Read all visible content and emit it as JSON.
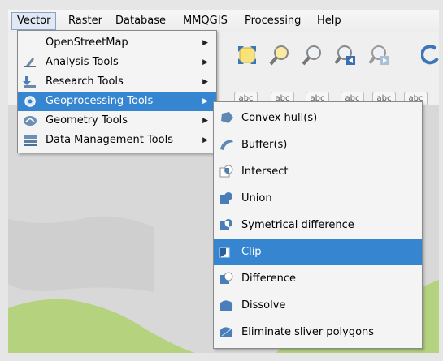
{
  "menubar": {
    "items": [
      "Vector",
      "Raster",
      "Database",
      "MMQGIS",
      "Processing",
      "Help"
    ],
    "active": "Vector"
  },
  "vector_menu": {
    "items": [
      {
        "label": "OpenStreetMap",
        "icon": "none",
        "has_submenu": true
      },
      {
        "label": "Analysis Tools",
        "icon": "analysis-icon",
        "has_submenu": true
      },
      {
        "label": "Research Tools",
        "icon": "research-icon",
        "has_submenu": true
      },
      {
        "label": "Geoprocessing Tools",
        "icon": "gear-icon",
        "has_submenu": true,
        "highlighted": true
      },
      {
        "label": "Geometry Tools",
        "icon": "geometry-icon",
        "has_submenu": true
      },
      {
        "label": "Data Management Tools",
        "icon": "data-management-icon",
        "has_submenu": true
      }
    ]
  },
  "geoprocessing_menu": {
    "items": [
      {
        "label": "Convex hull(s)",
        "icon": "convex-hull-icon"
      },
      {
        "label": "Buffer(s)",
        "icon": "buffer-icon"
      },
      {
        "label": "Intersect",
        "icon": "intersect-icon"
      },
      {
        "label": "Union",
        "icon": "union-icon"
      },
      {
        "label": "Symetrical difference",
        "icon": "symmetrical-difference-icon"
      },
      {
        "label": "Clip",
        "icon": "clip-icon",
        "highlighted": true
      },
      {
        "label": "Difference",
        "icon": "difference-icon"
      },
      {
        "label": "Dissolve",
        "icon": "dissolve-icon"
      },
      {
        "label": "Eliminate sliver polygons",
        "icon": "eliminate-sliver-icon"
      }
    ]
  },
  "toolbar": {
    "label_buttons": [
      "abc",
      "abc",
      "abc",
      "abc",
      "abc",
      "abc"
    ]
  },
  "colors": {
    "highlight": "#3585d0",
    "map_green": "#b5d37f",
    "menu_bg": "#f4f4f4",
    "icon_blue": "#4a7eb8"
  }
}
